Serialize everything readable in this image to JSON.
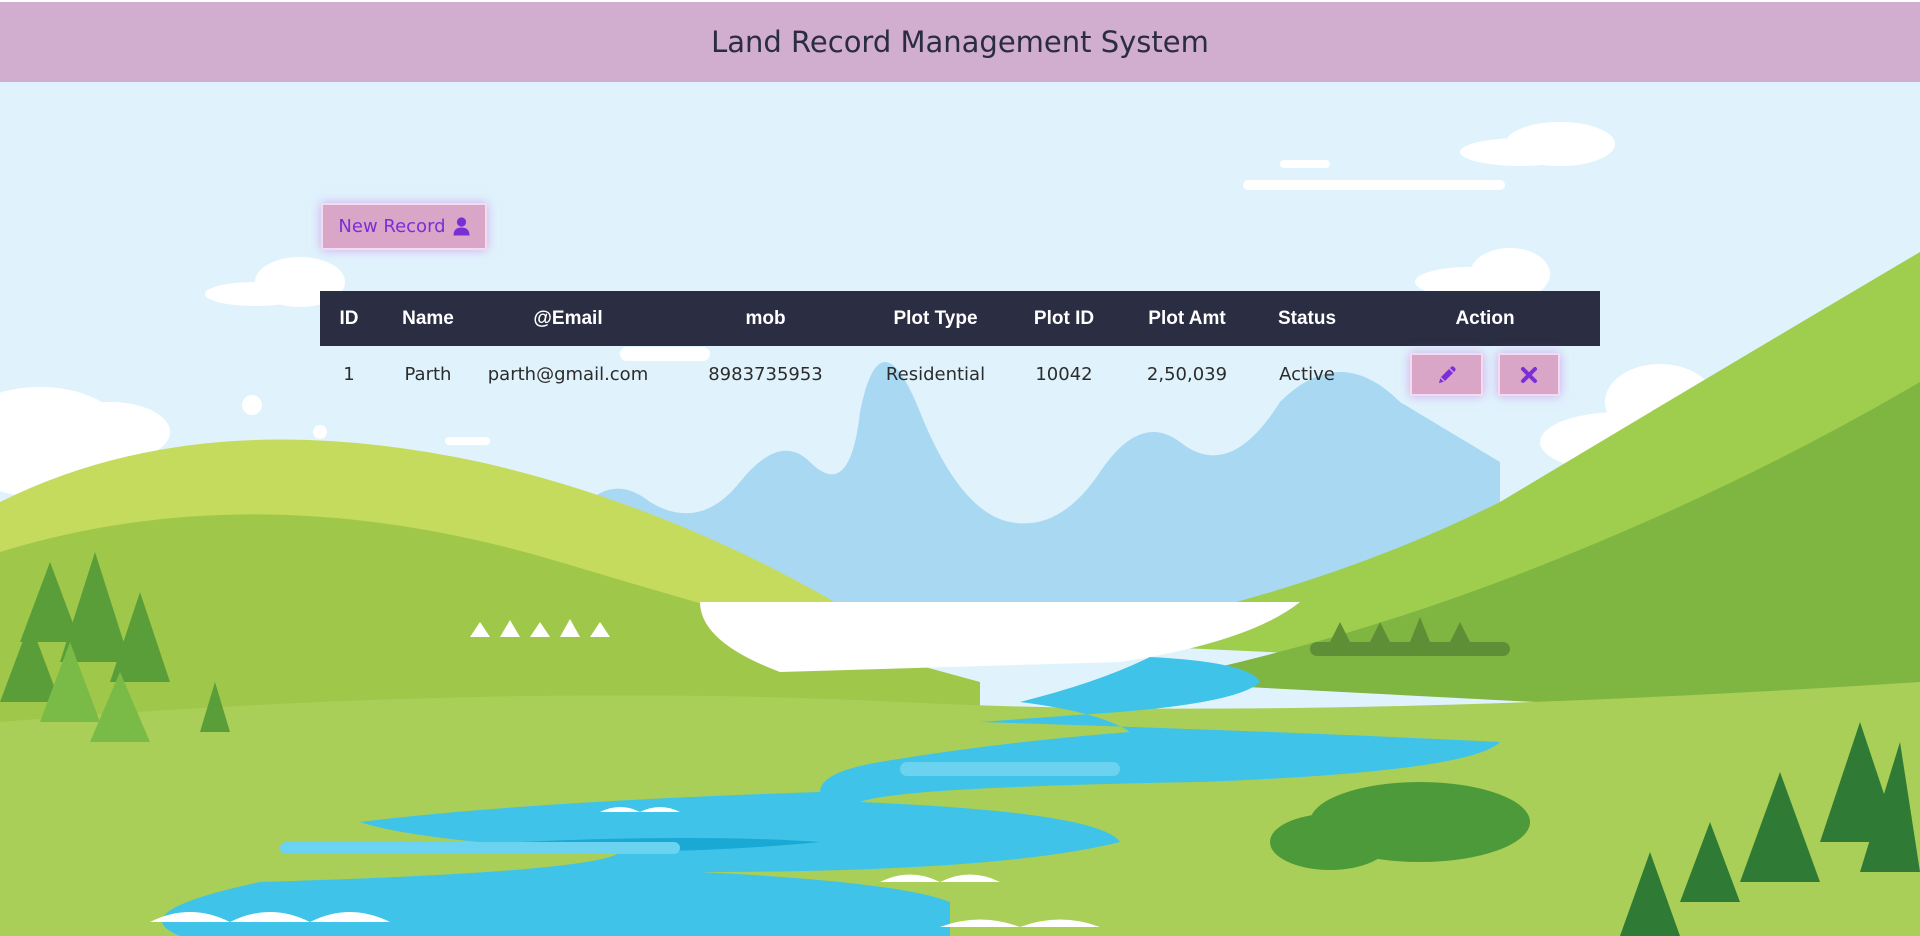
{
  "header": {
    "title": "Land Record Management System"
  },
  "toolbar": {
    "new_record_label": "New Record",
    "new_record_icon": "user-icon"
  },
  "table": {
    "columns": [
      "ID",
      "Name",
      "@Email",
      "mob",
      "Plot Type",
      "Plot ID",
      "Plot Amt",
      "Status",
      "Action"
    ],
    "rows": [
      {
        "id": "1",
        "name": "Parth",
        "email": "parth@gmail.com",
        "mob": "8983735953",
        "plot_type": "Residential",
        "plot_id": "10042",
        "plot_amt": "2,50,039",
        "status": "Active",
        "actions": [
          "pencil-icon",
          "close-icon"
        ]
      }
    ]
  },
  "colors": {
    "header_bg": "#d1adcf",
    "button_bg": "#d9a6c8",
    "icon_accent": "#7a2ed6",
    "table_header_bg": "#2b2d42"
  }
}
